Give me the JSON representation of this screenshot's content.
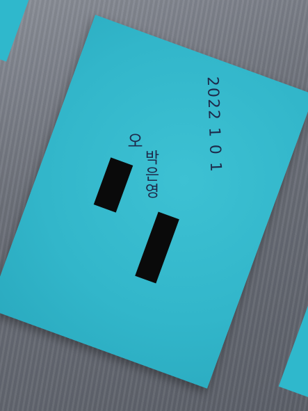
{
  "note": {
    "handwritten_date": "2022 1 0 1",
    "handwritten_name": "박은영",
    "handwritten_mark": "오"
  },
  "colors": {
    "note": "#32b6ca",
    "surface": "#6c7079",
    "ink": "#1e2a4a",
    "redaction": "#0a0a0a"
  }
}
